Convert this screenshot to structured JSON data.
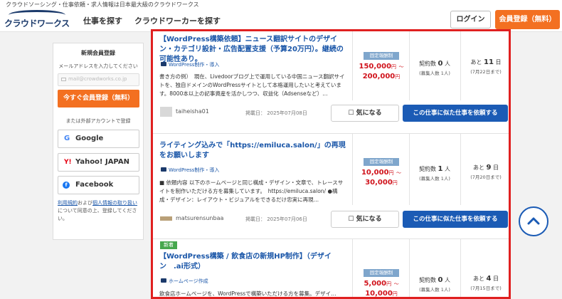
{
  "header": {
    "tagline": "クラウドソーシング・仕事依頼・求人情報は日本最大級のクラウドワークス",
    "logo": "クラウドワークス",
    "nav": [
      "仕事を探す",
      "クラウドワーカーを探す"
    ],
    "login": "ログイン",
    "register": "会員登録（無料）"
  },
  "sidebar": {
    "title": "新規会員登録",
    "email_label": "メールアドレスを入力してください",
    "email_placeholder": "mail@crowdworks.co.jp",
    "cta": "今すぐ会員登録（無料）",
    "or": "または外部アカウントで登録",
    "google": "Google",
    "yahoo": "Yahoo! JAPAN ID",
    "facebook": "Facebook",
    "terms_link1": "利用規約",
    "terms_mid": "および",
    "terms_link2": "個人情報の取り扱い",
    "terms_tail": "について同意の上、登録してください。"
  },
  "jobs": [
    {
      "title": "【WordPress構築依頼】ニュース翻訳サイトのデザイン・カテゴリ設計・広告配置支援（予算20万円）。継続の可能性あり。",
      "category": "WordPress制作・導入",
      "description": "書き方の例）　現在、Livedoorブログ上で運用している中国ニュース翻訳サイトを、独自ドメインのWordPressサイトとして本格運用したいと考えています。8000本以上の記事資産を活かしつつ、収益化（Adsenseなど）…",
      "user": "taiheisha01",
      "posted": "掲載日： 2025年07月08日",
      "badge": "固定報酬制",
      "price_min": "150,000",
      "price_max": "200,000",
      "yen": "円",
      "tilde": "～",
      "contracts_label": "契約数",
      "contracts": "0",
      "unit_person": "人",
      "recruit": "(募集人数 1人)",
      "remaining_prefix": "あと",
      "remaining": "11",
      "remaining_unit": "日",
      "deadline": "(7月22日まで)",
      "fav": "気になる",
      "request": "この仕事に似た仕事を依頼する"
    },
    {
      "title": "ライティング込みで「https://emiluca.salon/」の再現をお願いします",
      "category": "WordPress制作・導入",
      "description": "■ 依頼内容 以下のホームページと同じ構成・デザイン・文章で、トレースサイトを制作いただける方を募集しています。　https://emiluca.salon/ ●構成・デザイン：レイアウト・ビジュアルをできるだけ忠実に再現…",
      "user": "matsurensunbaa",
      "posted": "掲載日： 2025年07月06日",
      "badge": "固定報酬制",
      "price_min": "10,000",
      "price_max": "30,000",
      "yen": "円",
      "tilde": "～",
      "contracts_label": "契約数",
      "contracts": "1",
      "unit_person": "人",
      "recruit": "(募集人数 1人)",
      "remaining_prefix": "あと",
      "remaining": "9",
      "remaining_unit": "日",
      "deadline": "(7月20日まで)",
      "fav": "気になる",
      "request": "この仕事に似た仕事を依頼する"
    },
    {
      "new": "新着",
      "title": "【WordPress構築 / 飲食店の新規HP制作】（デザイン　.ai形式）",
      "category": "ホームページ作成",
      "description": "飲食店ホームページを、WordPressで構築いただける方を募集。デザイ…",
      "badge": "固定報酬制",
      "price_min": "5,000",
      "price_max": "10,000",
      "yen": "円",
      "tilde": "～",
      "contracts_label": "契約数",
      "contracts": "0",
      "unit_person": "人",
      "recruit": "(募集人数 1人)",
      "remaining_prefix": "あと",
      "remaining": "4",
      "remaining_unit": "日",
      "deadline": "(7月15日まで)"
    }
  ]
}
